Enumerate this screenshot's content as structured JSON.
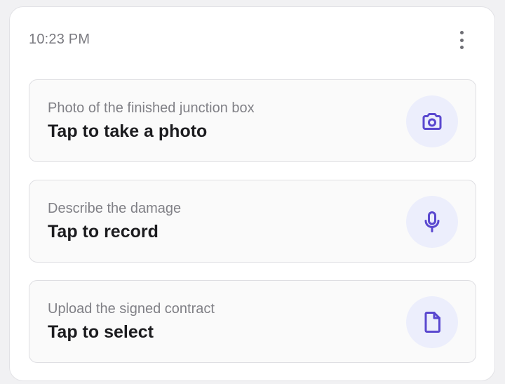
{
  "header": {
    "time": "10:23 PM",
    "menu_icon": "more-vertical-icon"
  },
  "fields": [
    {
      "label": "Photo of the finished junction box",
      "action": "Tap to take a photo",
      "icon": "camera-icon"
    },
    {
      "label": "Describe the damage",
      "action": "Tap to record",
      "icon": "microphone-icon"
    },
    {
      "label": "Upload the signed contract",
      "action": "Tap to select",
      "icon": "document-icon"
    }
  ],
  "colors": {
    "accent": "#5a48cf",
    "icon_background": "#eceefc",
    "field_background": "#fafafa",
    "border": "#dedee2"
  }
}
